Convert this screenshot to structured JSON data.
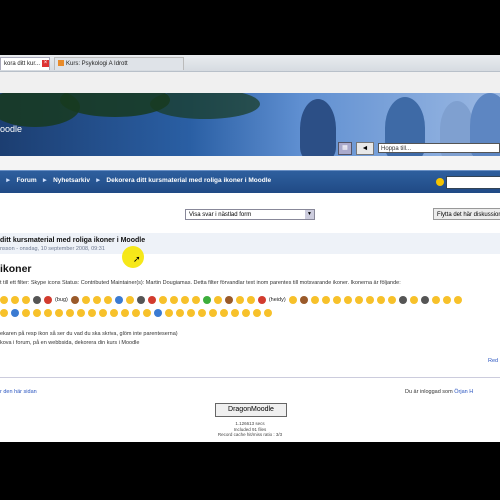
{
  "browser": {
    "tabs": [
      {
        "label": "kora ditt kur..."
      },
      {
        "label": "Kurs: Psykologi A Idrott"
      }
    ]
  },
  "banner": {
    "site_name": "oodle",
    "search_placeholder": "Hoppa till...",
    "go_label": "◄"
  },
  "navbar": {
    "breadcrumb": [
      "Forum",
      "Nyhetsarkiv",
      "Dekorera ditt kursmaterial med roliga ikoner i Moodle"
    ]
  },
  "toolbar": {
    "view_select_value": "Visa svar i nästlad form",
    "move_button_label": "Flytta det här diskussionsämnet"
  },
  "post": {
    "title": "ditt kursmaterial med roliga ikoner i Moodle",
    "author_line": "nsson - onsdag, 10 september 2008, 09:31",
    "heading": "ikoner",
    "filter_description": "t till ett filter: Skype icons Status: Contributed Maintainer(s): Martin Dougiamas. Detta filter förvandlar text inom parentes till motsvarande ikoner. Ikonerna är följande:",
    "emoji_tag_1": "(bug)",
    "emoji_tag_2": "(heidy)",
    "info_line_1": "ekaren på resp ikon så ser du vad du ska skriva, glöm inte parenteserna)",
    "info_line_2": "kova i forum, på en webbsida, dekorera din kurs i Moodle",
    "read_more": "Red"
  },
  "footer": {
    "rate_link": "r den här sidan",
    "logged_in_text": "Du är inloggad som",
    "user_link": "Örjan H",
    "home_button": "DragonMoodle",
    "perf_line_1": "1.126613 secs",
    "perf_line_2": "Included 91 files",
    "perf_line_3": "Record cache hit/miss ratio : 3/3"
  }
}
